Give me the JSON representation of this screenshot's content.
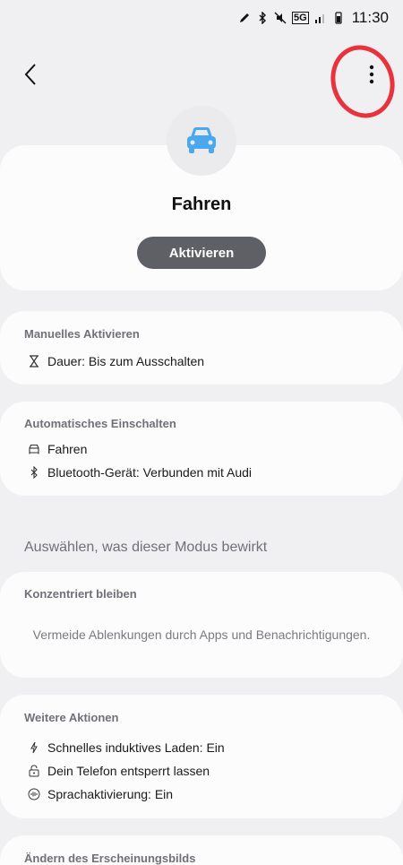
{
  "status_bar": {
    "time": "11:30",
    "network": "5G"
  },
  "mode": {
    "title": "Fahren",
    "activate_label": "Aktivieren",
    "icon": "car-icon",
    "accent": "#4aa8f0"
  },
  "manual": {
    "title": "Manuelles Aktivieren",
    "items": [
      {
        "icon": "hourglass-icon",
        "label": "Dauer: Bis zum Ausschalten"
      }
    ]
  },
  "auto": {
    "title": "Automatisches Einschalten",
    "items": [
      {
        "icon": "car-outline-icon",
        "label": "Fahren"
      },
      {
        "icon": "bluetooth-icon",
        "label": "Bluetooth-Gerät: Verbunden mit Audi"
      }
    ]
  },
  "section_heading": "Auswählen, was dieser Modus bewirkt",
  "focus": {
    "title": "Konzentriert bleiben",
    "description": "Vermeide Ablenkungen durch Apps und Benachrichtigungen."
  },
  "more_actions": {
    "title": "Weitere Aktionen",
    "items": [
      {
        "icon": "charging-icon",
        "label": "Schnelles induktives Laden: Ein"
      },
      {
        "icon": "lock-open-icon",
        "label": "Dein Telefon entsperrt lassen"
      },
      {
        "icon": "voice-icon",
        "label": "Sprachaktivierung: Ein"
      }
    ]
  },
  "appearance": {
    "title": "Ändern des Erscheinungsbilds"
  }
}
